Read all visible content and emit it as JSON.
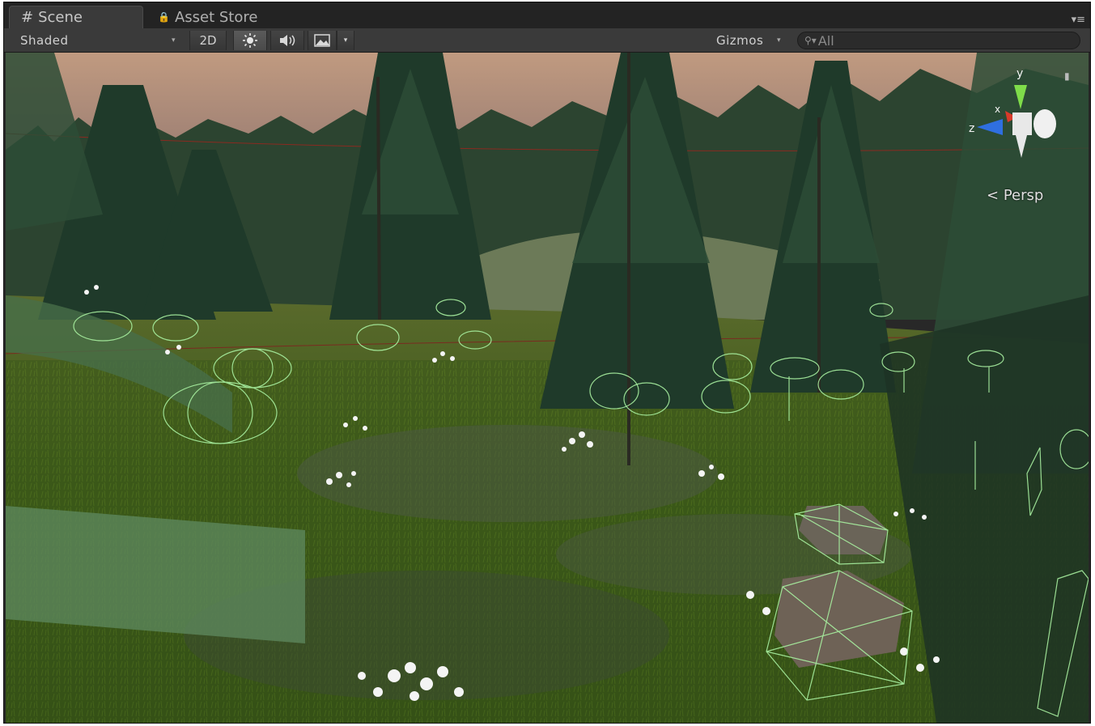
{
  "tabs": [
    {
      "label": "Scene",
      "icon": "grid-icon",
      "active": true
    },
    {
      "label": "Asset Store",
      "icon": "lock-icon",
      "active": false
    }
  ],
  "tab_menu_icon": "panel-menu-icon",
  "toolbar": {
    "shading_mode": "Shaded",
    "mode_2d_label": "2D",
    "lighting_icon": "sun-icon",
    "audio_icon": "speaker-icon",
    "effects_icon": "image-icon",
    "gizmos_label": "Gizmos",
    "search_placeholder": "All"
  },
  "scene": {
    "projection_label": "Persp",
    "gizmo_axes": {
      "y": "y",
      "x": "x",
      "z": "z"
    },
    "colors": {
      "sky_top": "#b89680",
      "sky_low": "#8f7a78",
      "grass": "#3a5a1a",
      "tree": "#223a2c",
      "wire": "#a8f0a0"
    }
  }
}
